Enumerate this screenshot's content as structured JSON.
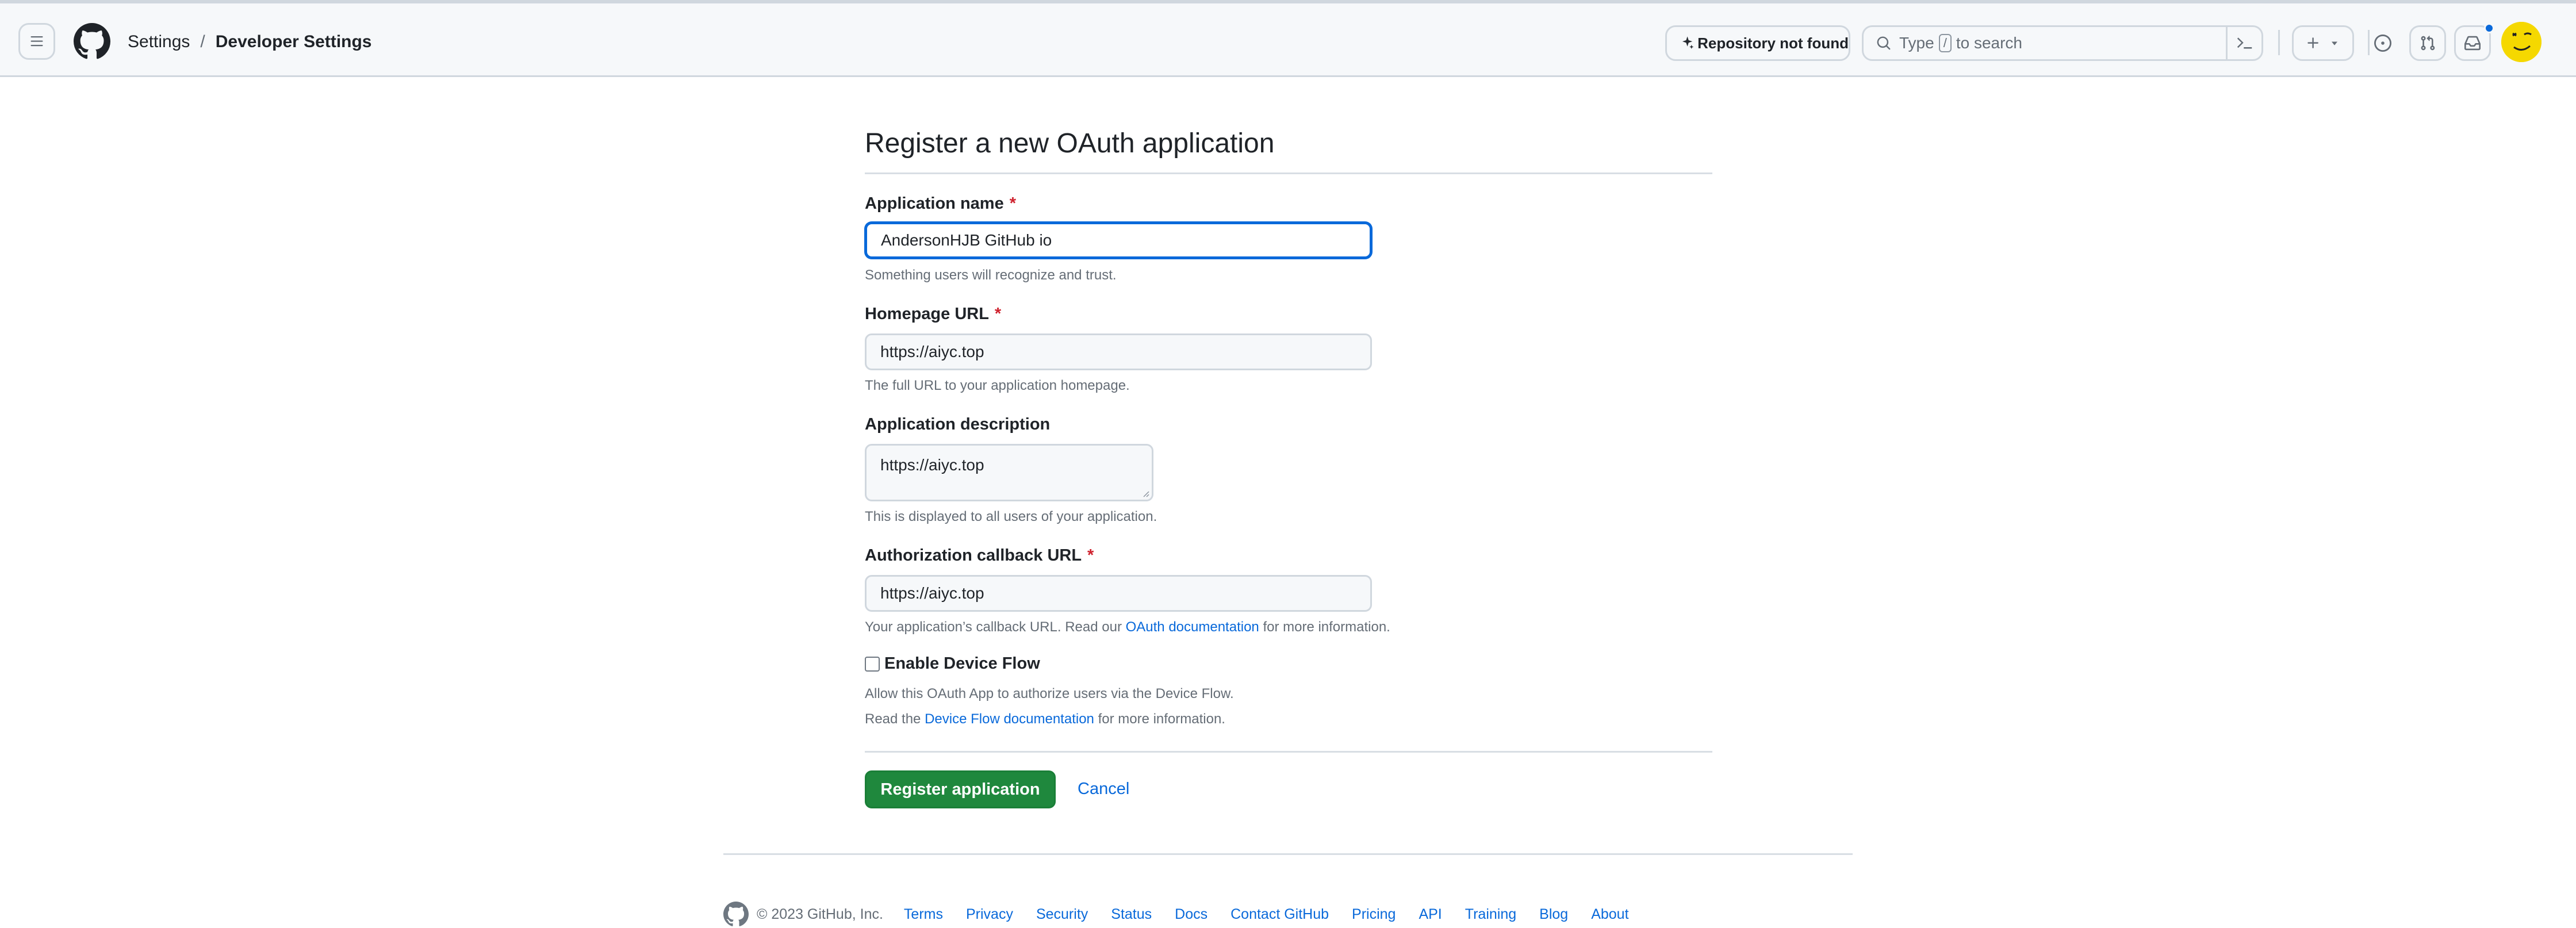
{
  "header": {
    "breadcrumb": {
      "parent": "Settings",
      "separator": "/",
      "current": "Developer Settings"
    },
    "repo_status": "Repository not found",
    "search": {
      "prefix": "Type",
      "key": "/",
      "suffix": "to search"
    },
    "icons": [
      "hamburger-icon",
      "github-logo-icon",
      "copilot-icon",
      "search-icon",
      "command-palette-icon",
      "plus-icon",
      "chevron-down-icon",
      "issues-icon",
      "pull-requests-icon",
      "inbox-icon"
    ]
  },
  "form": {
    "title": "Register a new OAuth application",
    "app_name": {
      "label": "Application name",
      "required": "*",
      "value": "AndersonHJB GitHub io",
      "hint": "Something users will recognize and trust."
    },
    "homepage": {
      "label": "Homepage URL",
      "required": "*",
      "value": "https://aiyc.top",
      "hint": "The full URL to your application homepage."
    },
    "description": {
      "label": "Application description",
      "value": "https://aiyc.top",
      "hint": "This is displayed to all users of your application."
    },
    "callback": {
      "label": "Authorization callback URL",
      "required": "*",
      "value": "https://aiyc.top",
      "hint_prefix": "Your application’s callback URL. Read our",
      "hint_link": "OAuth documentation",
      "hint_suffix": "for more information."
    },
    "device_flow": {
      "label": "Enable Device Flow",
      "checked": false,
      "hint1": "Allow this OAuth App to authorize users via the Device Flow.",
      "hint2_prefix": "Read the",
      "hint2_link": "Device Flow documentation",
      "hint2_suffix": "for more information."
    },
    "submit_label": "Register application",
    "cancel_label": "Cancel"
  },
  "footer": {
    "copyright": "© 2023 GitHub, Inc.",
    "links": [
      "Terms",
      "Privacy",
      "Security",
      "Status",
      "Docs",
      "Contact GitHub",
      "Pricing",
      "API",
      "Training",
      "Blog",
      "About"
    ]
  },
  "colors": {
    "accent": "#0969da",
    "primary_button": "#1f883d",
    "required": "#cf222e"
  }
}
